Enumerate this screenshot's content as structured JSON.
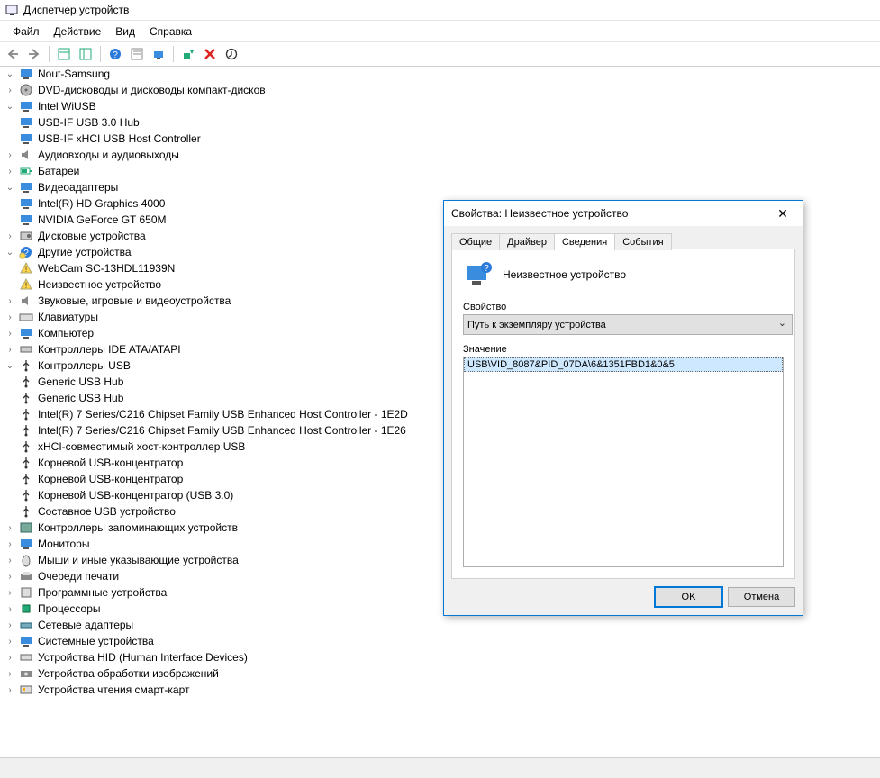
{
  "window": {
    "title": "Диспетчер устройств"
  },
  "menu": {
    "file": "Файл",
    "action": "Действие",
    "view": "Вид",
    "help": "Справка"
  },
  "tree": {
    "root": "Nout-Samsung",
    "dvd": "DVD-дисководы и дисководы компакт-дисков",
    "wiusb": "Intel WiUSB",
    "wiusb_hub": "USB-IF USB 3.0 Hub",
    "wiusb_xhci": "USB-IF xHCI USB Host Controller",
    "audio": "Аудиовходы и аудиовыходы",
    "battery": "Батареи",
    "video": "Видеоадаптеры",
    "video_hd": "Intel(R) HD Graphics 4000",
    "video_nv": "NVIDIA GeForce GT 650M",
    "disk": "Дисковые устройства",
    "other": "Другие устройства",
    "other_cam": "WebCam SC-13HDL11939N",
    "other_unknown": "Неизвестное устройство",
    "sound": "Звуковые, игровые и видеоустройства",
    "keyboard": "Клавиатуры",
    "computer": "Компьютер",
    "ide": "Контроллеры IDE ATA/ATAPI",
    "usb": "Контроллеры USB",
    "usb_items": [
      "Generic USB Hub",
      "Generic USB Hub",
      "Intel(R) 7 Series/C216 Chipset Family USB Enhanced Host Controller - 1E2D",
      "Intel(R) 7 Series/C216 Chipset Family USB Enhanced Host Controller - 1E26",
      "xHCI-совместимый хост-контроллер USB",
      "Корневой USB-концентратор",
      "Корневой USB-концентратор",
      "Корневой USB-концентратор (USB 3.0)",
      "Составное USB устройство"
    ],
    "storage": "Контроллеры запоминающих устройств",
    "monitor": "Мониторы",
    "mouse": "Мыши и иные указывающие устройства",
    "print": "Очереди печати",
    "software": "Программные устройства",
    "cpu": "Процессоры",
    "net": "Сетевые адаптеры",
    "system": "Системные устройства",
    "hid": "Устройства HID (Human Interface Devices)",
    "imaging": "Устройства обработки изображений",
    "smartcard": "Устройства чтения смарт-карт"
  },
  "dialog": {
    "title": "Свойства: Неизвестное устройство",
    "tabs": {
      "general": "Общие",
      "driver": "Драйвер",
      "details": "Сведения",
      "events": "События"
    },
    "device_name": "Неизвестное устройство",
    "property_label": "Свойство",
    "property_value": "Путь к экземпляру устройства",
    "value_label": "Значение",
    "value_item": "USB\\VID_8087&PID_07DA\\6&1351FBD1&0&5",
    "ok": "OK",
    "cancel": "Отмена"
  }
}
